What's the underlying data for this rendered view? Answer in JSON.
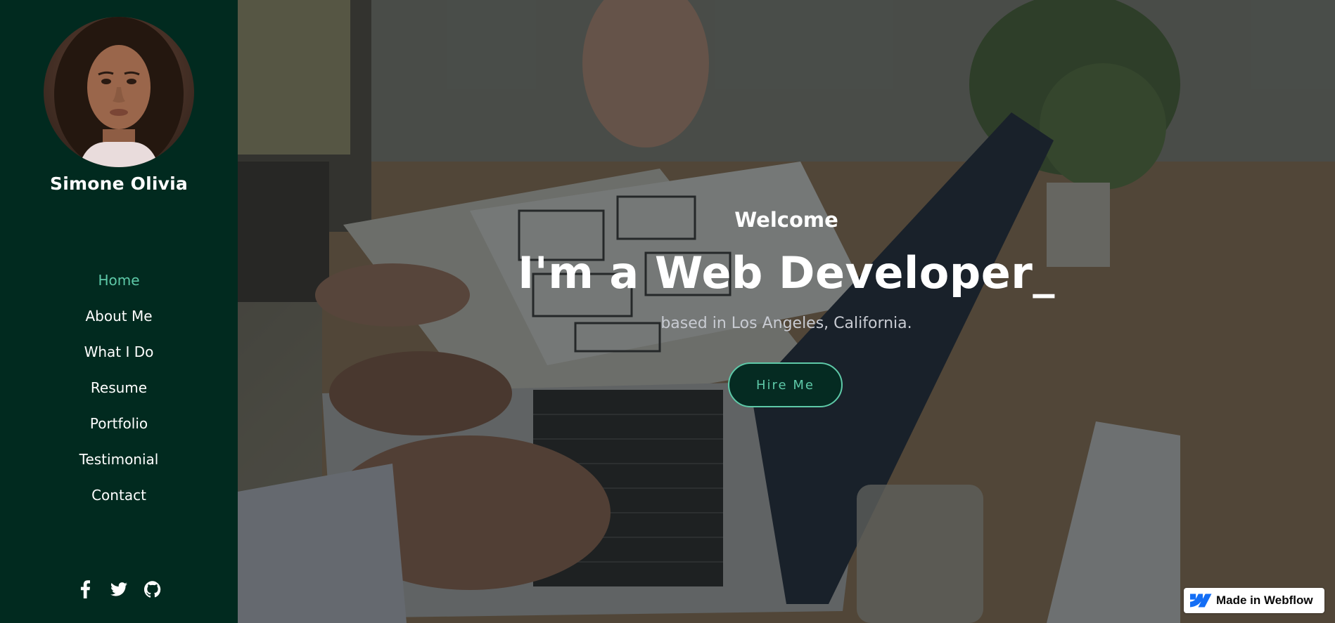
{
  "sidebar": {
    "name": "Simone Olivia",
    "nav": [
      {
        "label": "Home",
        "active": true
      },
      {
        "label": "About Me",
        "active": false
      },
      {
        "label": "What I Do",
        "active": false
      },
      {
        "label": "Resume",
        "active": false
      },
      {
        "label": "Portfolio",
        "active": false
      },
      {
        "label": "Testimonial",
        "active": false
      },
      {
        "label": "Contact",
        "active": false
      }
    ],
    "socials": [
      "facebook-icon",
      "twitter-icon",
      "github-icon"
    ]
  },
  "hero": {
    "welcome": "Welcome",
    "headline": "I'm a Web Developer_",
    "subline": "based in Los Angeles, California.",
    "cta_label": "Hire Me"
  },
  "badge": {
    "label": "Made in Webflow"
  },
  "colors": {
    "sidebar_bg": "#012a1f",
    "accent": "#5ec9a8",
    "button_bg": "#052b22",
    "webflow_blue": "#146ef5"
  }
}
